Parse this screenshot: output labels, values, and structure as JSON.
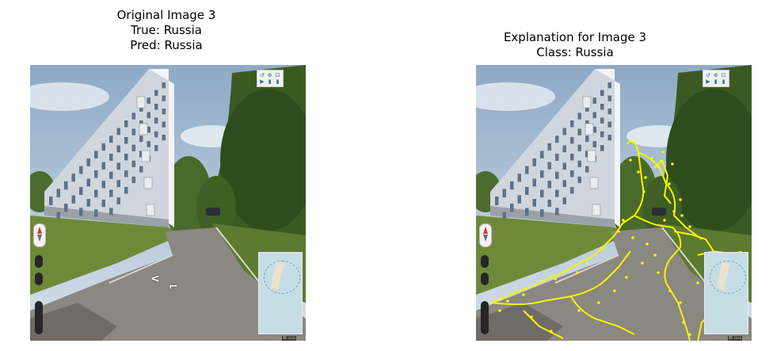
{
  "left_panel": {
    "title_line1": "Original Image 3",
    "title_line2": "True: Russia",
    "title_line3": "Pred: Russia",
    "overlay": false
  },
  "right_panel": {
    "title_line1": "Explanation for Image 3",
    "title_line2": "Class: Russia",
    "overlay": true,
    "overlay_color": "#f5f500"
  },
  "colors": {
    "sky": "#a8bccf",
    "building": "#e4e9ee",
    "trees": "#3c5a22",
    "grass": "#6e8a39",
    "road": "#8b8781"
  }
}
